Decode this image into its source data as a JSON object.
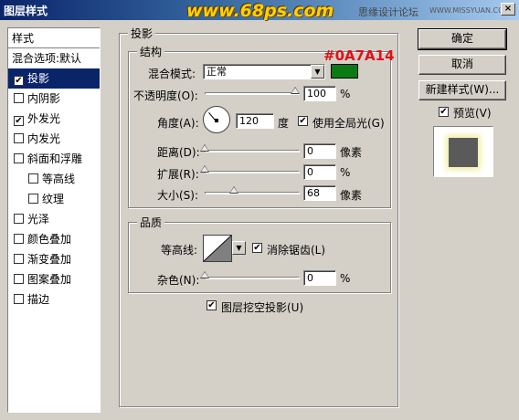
{
  "window": {
    "title": "图层样式",
    "logo": "www.68ps.com",
    "watermark": "思缘设计论坛",
    "watermark_url": "WWW.MISSYUAN.COM",
    "close": "×"
  },
  "styles": {
    "header": "样式",
    "blend_options": "混合选项:默认",
    "items": [
      {
        "label": "投影",
        "checked": "✔",
        "selected": true
      },
      {
        "label": "内阴影",
        "checked": ""
      },
      {
        "label": "外发光",
        "checked": "✔"
      },
      {
        "label": "内发光",
        "checked": ""
      },
      {
        "label": "斜面和浮雕",
        "checked": ""
      },
      {
        "label": "等高线",
        "checked": ""
      },
      {
        "label": "纹理",
        "checked": ""
      },
      {
        "label": "光泽",
        "checked": ""
      },
      {
        "label": "颜色叠加",
        "checked": ""
      },
      {
        "label": "渐变叠加",
        "checked": ""
      },
      {
        "label": "图案叠加",
        "checked": ""
      },
      {
        "label": "描边",
        "checked": ""
      }
    ]
  },
  "drop_shadow": {
    "title": "投影",
    "structure_title": "结构",
    "blend_mode_label": "混合模式:",
    "blend_mode_value": "正常",
    "color_annotation": "#0A7A14",
    "shadow_color": "#0A7A14",
    "opacity_label": "不透明度(O):",
    "opacity_value": "100",
    "opacity_unit": "%",
    "angle_label": "角度(A):",
    "angle_value": "120",
    "angle_unit": "度",
    "global_light_label": "使用全局光(G)",
    "global_light_check": "✔",
    "distance_label": "距离(D):",
    "distance_value": "0",
    "distance_unit": "像素",
    "spread_label": "扩展(R):",
    "spread_value": "0",
    "spread_unit": "%",
    "size_label": "大小(S):",
    "size_value": "68",
    "size_unit": "像素"
  },
  "quality": {
    "title": "品质",
    "contour_label": "等高线:",
    "antialias_label": "消除锯齿(L)",
    "antialias_check": "✔",
    "noise_label": "杂色(N):",
    "noise_value": "0",
    "noise_unit": "%",
    "knockout_label": "图层挖空投影(U)",
    "knockout_check": "✔"
  },
  "buttons": {
    "ok": "确定",
    "cancel": "取消",
    "new_style": "新建样式(W)...",
    "preview_label": "预览(V)",
    "preview_check": "✔"
  }
}
